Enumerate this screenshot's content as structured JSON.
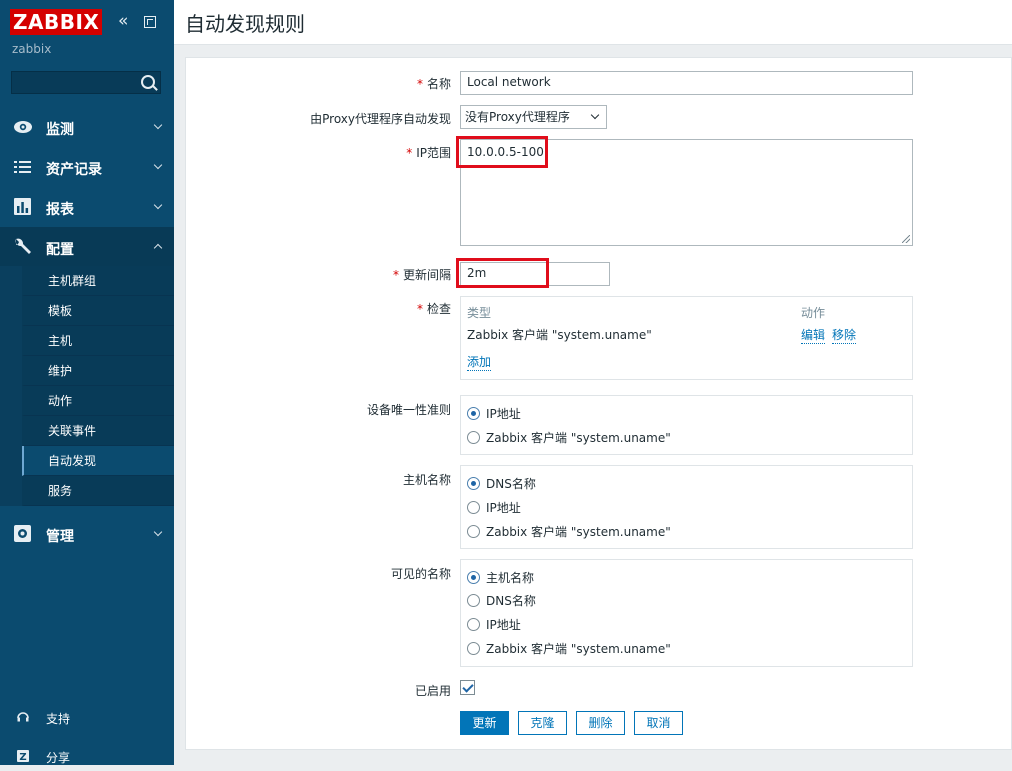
{
  "sidebar": {
    "logo": "ZABBIX",
    "server": "zabbix",
    "search_placeholder": "",
    "nav": [
      {
        "label": "监测",
        "icon": "eye-icon"
      },
      {
        "label": "资产记录",
        "icon": "list-icon"
      },
      {
        "label": "报表",
        "icon": "bar-chart-icon"
      },
      {
        "label": "配置",
        "icon": "wrench-icon"
      },
      {
        "label": "管理",
        "icon": "gear-icon"
      }
    ],
    "submenu": [
      "主机群组",
      "模板",
      "主机",
      "维护",
      "动作",
      "关联事件",
      "自动发现",
      "服务"
    ],
    "bottom": [
      {
        "label": "支持",
        "icon": "headset-icon"
      },
      {
        "label": "分享",
        "icon": "share-icon"
      }
    ]
  },
  "header": {
    "title": "自动发现规则"
  },
  "form": {
    "name": {
      "label": "名称",
      "value": "Local network"
    },
    "proxy": {
      "label": "由Proxy代理程序自动发现",
      "value": "没有Proxy代理程序"
    },
    "ip_range": {
      "label": "IP范围",
      "value": "10.0.0.5-100"
    },
    "interval": {
      "label": "更新间隔",
      "value": "2m"
    },
    "checks": {
      "label": "检查",
      "col_type": "类型",
      "col_action": "动作",
      "rows": [
        {
          "type": "Zabbix 客户端 \"system.uname\"",
          "edit": "编辑",
          "remove": "移除"
        }
      ],
      "add": "添加"
    },
    "uniqueness": {
      "label": "设备唯一性准则",
      "options": [
        "IP地址",
        "Zabbix 客户端 \"system.uname\""
      ],
      "selected": 0
    },
    "host_name": {
      "label": "主机名称",
      "options": [
        "DNS名称",
        "IP地址",
        "Zabbix 客户端 \"system.uname\""
      ],
      "selected": 0
    },
    "visible_name": {
      "label": "可见的名称",
      "options": [
        "主机名称",
        "DNS名称",
        "IP地址",
        "Zabbix 客户端 \"system.uname\""
      ],
      "selected": 0
    },
    "enabled": {
      "label": "已启用",
      "checked": true
    },
    "buttons": {
      "update": "更新",
      "clone": "克隆",
      "delete": "删除",
      "cancel": "取消"
    }
  },
  "colors": {
    "sidebar": "#0b4b6f",
    "accent": "#0275b8",
    "highlight": "#e00d1b"
  }
}
